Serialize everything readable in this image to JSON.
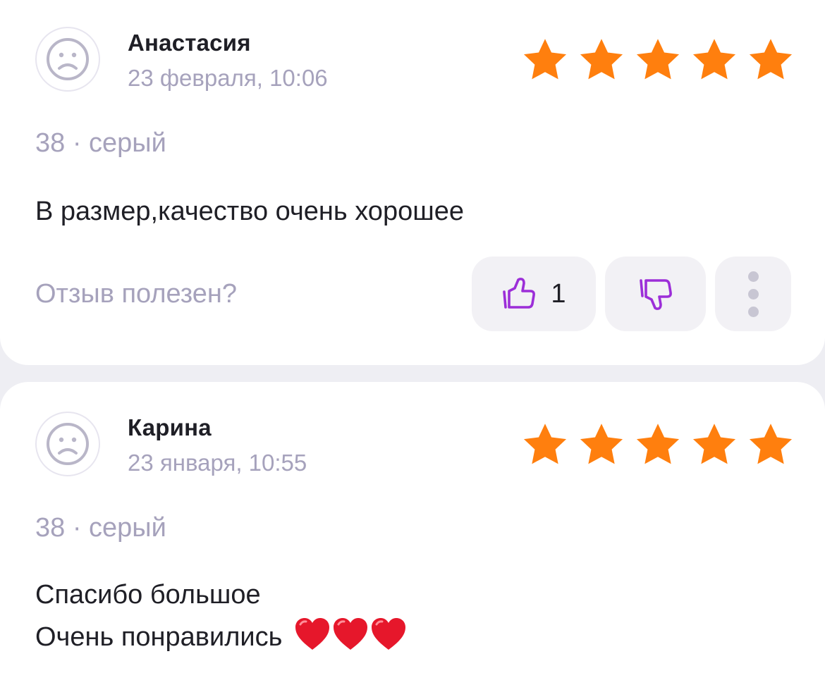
{
  "colors": {
    "star": "#ff7f0e",
    "accent": "#9c2ed8",
    "muted": "#a6a2bc",
    "text": "#1f1f26",
    "heart": "#e6172b"
  },
  "reviews": [
    {
      "author": "Анастасия",
      "date": "23 февраля, 10:06",
      "rating": 5,
      "variant": "38 · серый",
      "text_lines": [
        "В размер,качество очень хорошее"
      ]
    },
    {
      "author": "Карина",
      "date": "23 января, 10:55",
      "rating": 5,
      "variant": "38 · серый",
      "text_lines": [
        "Спасибо большое",
        "Очень понравились"
      ],
      "emoji": [
        "heart",
        "heart",
        "heart"
      ]
    }
  ],
  "helpful": {
    "question": "Отзыв полезен?",
    "like_count": "1",
    "icons": [
      "thumbs-up-icon",
      "thumbs-down-icon",
      "more-vertical-icon"
    ]
  }
}
